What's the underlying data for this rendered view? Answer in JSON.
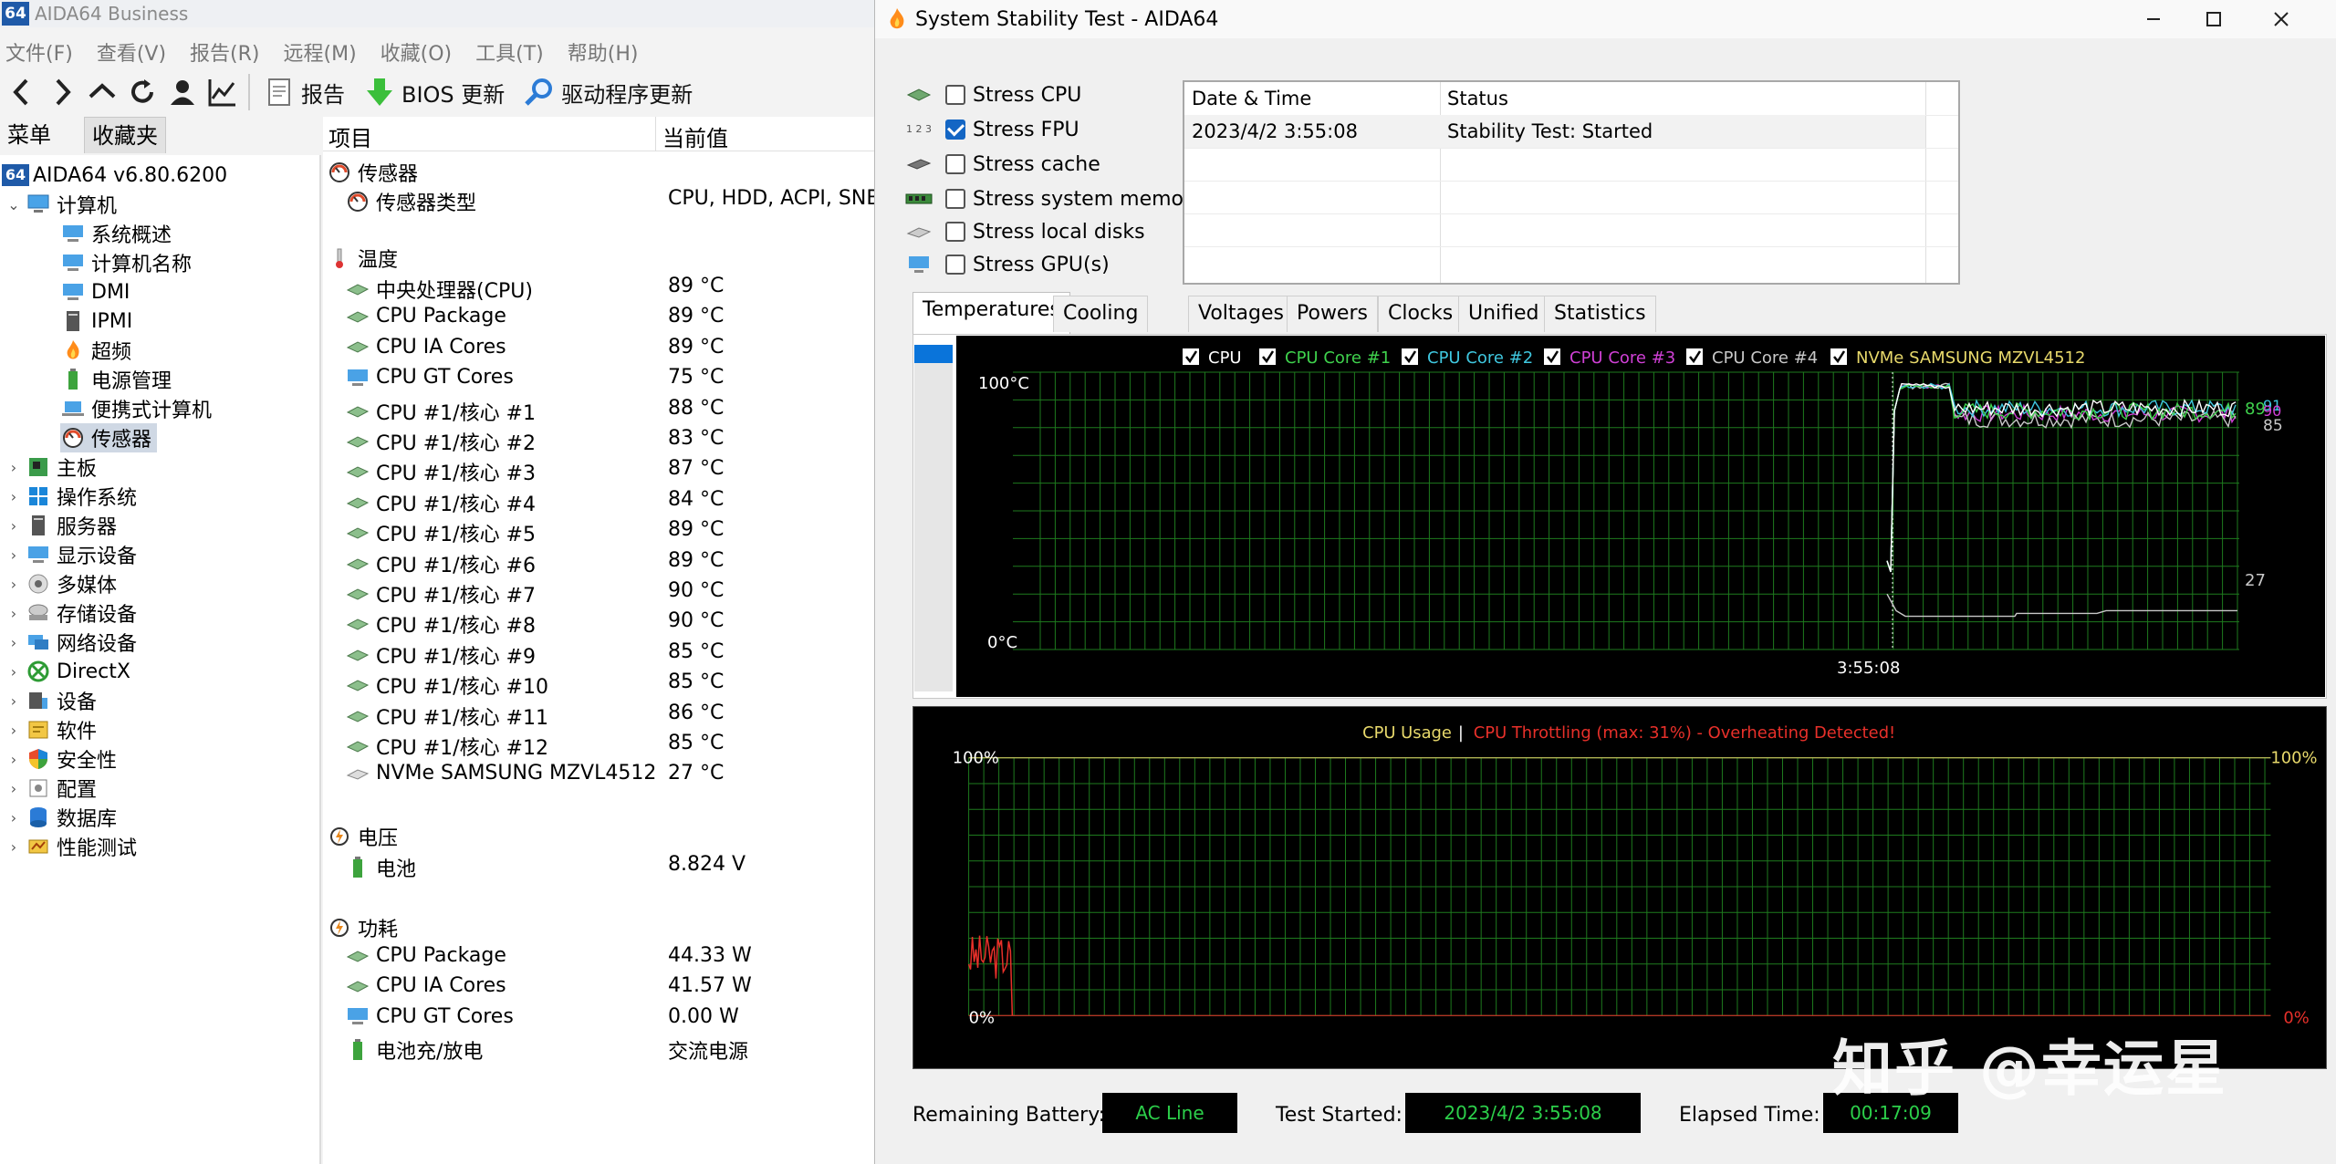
{
  "aida": {
    "title": "AIDA64 Business",
    "logo_text": "64",
    "menu": [
      "文件(F)",
      "查看(V)",
      "报告(R)",
      "远程(M)",
      "收藏(O)",
      "工具(T)",
      "帮助(H)"
    ],
    "toolbar": {
      "report": "报告",
      "bios": "BIOS 更新",
      "driver": "驱动程序更新"
    },
    "tabs": [
      "菜单",
      "收藏夹"
    ],
    "tree": {
      "root": "AIDA64 v6.80.6200",
      "computer": "计算机",
      "computer_children": [
        "系统概述",
        "计算机名称",
        "DMI",
        "IPMI",
        "超频",
        "电源管理",
        "便携式计算机",
        "传感器"
      ],
      "top": [
        "主板",
        "操作系统",
        "服务器",
        "显示设备",
        "多媒体",
        "存储设备",
        "网络设备",
        "DirectX",
        "设备",
        "软件",
        "安全性",
        "配置",
        "数据库",
        "性能测试"
      ]
    },
    "list": {
      "col1": "项目",
      "col2": "当前值",
      "sensor_group": "传感器",
      "sensor_type_label": "传感器类型",
      "sensor_type_value": "CPU, HDD, ACPI, SNB",
      "temp_group": "温度",
      "temps": [
        {
          "n": "中央处理器(CPU)",
          "v": "89 °C"
        },
        {
          "n": "CPU Package",
          "v": "89 °C"
        },
        {
          "n": "CPU IA Cores",
          "v": "89 °C"
        },
        {
          "n": "CPU GT Cores",
          "v": "75 °C"
        },
        {
          "n": "CPU #1/核心 #1",
          "v": "88 °C"
        },
        {
          "n": "CPU #1/核心 #2",
          "v": "83 °C"
        },
        {
          "n": "CPU #1/核心 #3",
          "v": "87 °C"
        },
        {
          "n": "CPU #1/核心 #4",
          "v": "84 °C"
        },
        {
          "n": "CPU #1/核心 #5",
          "v": "89 °C"
        },
        {
          "n": "CPU #1/核心 #6",
          "v": "89 °C"
        },
        {
          "n": "CPU #1/核心 #7",
          "v": "90 °C"
        },
        {
          "n": "CPU #1/核心 #8",
          "v": "90 °C"
        },
        {
          "n": "CPU #1/核心 #9",
          "v": "85 °C"
        },
        {
          "n": "CPU #1/核心 #10",
          "v": "85 °C"
        },
        {
          "n": "CPU #1/核心 #11",
          "v": "86 °C"
        },
        {
          "n": "CPU #1/核心 #12",
          "v": "85 °C"
        },
        {
          "n": "NVMe SAMSUNG MZVL4512",
          "v": "27 °C"
        }
      ],
      "volt_group": "电压",
      "volts": [
        {
          "n": "电池",
          "v": "8.824 V"
        }
      ],
      "power_group": "功耗",
      "powers": [
        {
          "n": "CPU Package",
          "v": "44.33 W"
        },
        {
          "n": "CPU IA Cores",
          "v": "41.57 W"
        },
        {
          "n": "CPU GT Cores",
          "v": "0.00 W"
        },
        {
          "n": "电池充/放电",
          "v": "交流电源"
        }
      ]
    }
  },
  "sst": {
    "title": "System Stability Test - AIDA64",
    "stress": [
      {
        "label": "Stress CPU",
        "checked": false
      },
      {
        "label": "Stress FPU",
        "checked": true
      },
      {
        "label": "Stress cache",
        "checked": false
      },
      {
        "label": "Stress system memory",
        "checked": false
      },
      {
        "label": "Stress local disks",
        "checked": false
      },
      {
        "label": "Stress GPU(s)",
        "checked": false
      }
    ],
    "fpu_icon_text": "1 2 3",
    "status": {
      "h1": "Date & Time",
      "h2": "Status",
      "date": "2023/4/2 3:55:08",
      "status": "Stability Test: Started"
    },
    "tabs": [
      "Temperatures",
      "Cooling Fans",
      "Voltages",
      "Powers",
      "Clocks",
      "Unified",
      "Statistics"
    ],
    "temp_legend": [
      {
        "label": "CPU",
        "color": "#ffffff"
      },
      {
        "label": "CPU Core #1",
        "color": "#3fd24d"
      },
      {
        "label": "CPU Core #2",
        "color": "#3fc7df"
      },
      {
        "label": "CPU Core #3",
        "color": "#d040d6"
      },
      {
        "label": "CPU Core #4",
        "color": "#c8c8c8"
      },
      {
        "label": "NVMe SAMSUNG MZVL4512",
        "color": "#e8d96b"
      }
    ],
    "temp_axis": {
      "top": "100°C",
      "bottom": "0°C",
      "time": "3:55:08"
    },
    "temp_right_labels": {
      "l89": "89",
      "l90": "90",
      "l91": "91",
      "l85": "85",
      "l27": "27"
    },
    "cpu_chart": {
      "usage_label": "CPU Usage",
      "sep": "|",
      "throttle_label": "CPU Throttling (max: 31%) - Overheating Detected!",
      "top_left": "100%",
      "top_right": "100%",
      "bottom_left": "0%",
      "bottom_right": "0%"
    },
    "bottom": {
      "battery_label": "Remaining Battery:",
      "battery_value": "AC Line",
      "started_label": "Test Started:",
      "started_value": "2023/4/2 3:55:08",
      "elapsed_label": "Elapsed Time:",
      "elapsed_value": "00:17:09"
    },
    "watermark": "知乎 @幸运星"
  },
  "chart_data": [
    {
      "type": "line",
      "title": "",
      "xlabel": "",
      "ylabel": "",
      "ylim": [
        0,
        100
      ],
      "x_tick_labels": [
        "3:55:08"
      ],
      "y_tick_labels": [
        "100°C",
        "0°C"
      ],
      "series": [
        {
          "name": "CPU",
          "last_value": 89
        },
        {
          "name": "CPU Core #1",
          "last_value": 90
        },
        {
          "name": "CPU Core #2",
          "last_value": 91
        },
        {
          "name": "CPU Core #3",
          "last_value": 85
        },
        {
          "name": "CPU Core #4",
          "last_value": 85
        },
        {
          "name": "NVMe SAMSUNG MZVL4512",
          "last_value": 27
        }
      ]
    },
    {
      "type": "line",
      "title": "",
      "ylim": [
        0,
        100
      ],
      "y_tick_labels": [
        "100%",
        "0%"
      ],
      "series": [
        {
          "name": "CPU Usage"
        },
        {
          "name": "CPU Throttling (max: 31%) - Overheating Detected!",
          "max": 31
        }
      ]
    }
  ]
}
